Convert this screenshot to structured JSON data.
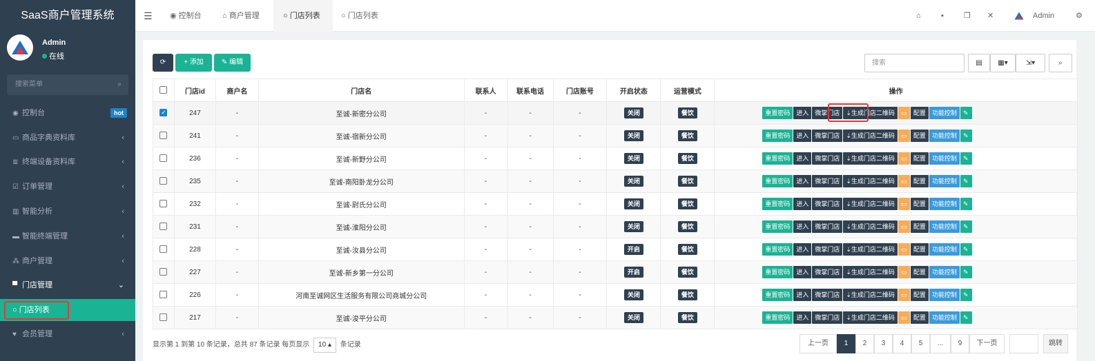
{
  "sidebar": {
    "brand": "SaaS商户管理系统",
    "user_name": "Admin",
    "user_status": "在线",
    "search_placeholder": "搜索菜单",
    "items": [
      {
        "icon": "dashboard-icon",
        "label": "控制台",
        "badge": "hot"
      },
      {
        "icon": "book-icon",
        "label": "商品字典资料库",
        "arrow": "‹"
      },
      {
        "icon": "database-icon",
        "label": "终端设备资料库",
        "arrow": "‹"
      },
      {
        "icon": "checklist-icon",
        "label": "订单管理",
        "arrow": "‹"
      },
      {
        "icon": "bar-chart-icon",
        "label": "智能分析",
        "arrow": "‹"
      },
      {
        "icon": "terminal-icon",
        "label": "智能终端管理",
        "arrow": "‹"
      },
      {
        "icon": "merchant-icon",
        "label": "商户管理",
        "arrow": "‹"
      },
      {
        "icon": "store-icon",
        "label": "门店管理",
        "arrow": "⌄"
      },
      {
        "icon": "member-icon",
        "label": "会员管理",
        "arrow": "‹"
      }
    ],
    "active_sub": "门店列表"
  },
  "topbar": {
    "menu_icon": "☰",
    "tabs": [
      {
        "icon": "dashboard-icon",
        "label": "控制台"
      },
      {
        "icon": "bank-icon",
        "label": "商户管理"
      },
      {
        "icon": "circle-icon",
        "label": "门店列表"
      },
      {
        "icon": "circle-icon",
        "label": "门店列表"
      }
    ],
    "admin": "Admin"
  },
  "toolbar": {
    "refresh": "⟳",
    "add": "+ 添加",
    "edit": "✎ 编辑",
    "search_placeholder": "搜索"
  },
  "table": {
    "headers": [
      "门店id",
      "商户名",
      "门店名",
      "联系人",
      "联系电话",
      "门店账号",
      "开启状态",
      "运营模式",
      "操作"
    ],
    "op_labels": [
      "重置密码",
      "进入",
      "微掌门店",
      "生成门店二维码",
      "配置",
      "功能控制"
    ],
    "rows": [
      {
        "id": "247",
        "merchant": "-",
        "name": "至诚-新密分公司",
        "contact": "-",
        "phone": "-",
        "account": "-",
        "status": "关闭",
        "mode": "餐饮",
        "checked": true
      },
      {
        "id": "241",
        "merchant": "-",
        "name": "至诚-宿新分公司",
        "contact": "-",
        "phone": "-",
        "account": "-",
        "status": "关闭",
        "mode": "餐饮",
        "checked": false
      },
      {
        "id": "236",
        "merchant": "-",
        "name": "至诚-新野分公司",
        "contact": "-",
        "phone": "-",
        "account": "-",
        "status": "关闭",
        "mode": "餐饮",
        "checked": false
      },
      {
        "id": "235",
        "merchant": "-",
        "name": "至诚-南阳卧龙分公司",
        "contact": "-",
        "phone": "-",
        "account": "-",
        "status": "关闭",
        "mode": "餐饮",
        "checked": false
      },
      {
        "id": "232",
        "merchant": "-",
        "name": "至诚-尉氏分公司",
        "contact": "-",
        "phone": "-",
        "account": "-",
        "status": "关闭",
        "mode": "餐饮",
        "checked": false
      },
      {
        "id": "231",
        "merchant": "-",
        "name": "至诚-淮阳分公司",
        "contact": "-",
        "phone": "-",
        "account": "-",
        "status": "关闭",
        "mode": "餐饮",
        "checked": false
      },
      {
        "id": "228",
        "merchant": "-",
        "name": "至诚-汝县分公司",
        "contact": "-",
        "phone": "-",
        "account": "-",
        "status": "开启",
        "mode": "餐饮",
        "checked": false
      },
      {
        "id": "227",
        "merchant": "-",
        "name": "至诚-新乡第一分公司",
        "contact": "-",
        "phone": "-",
        "account": "-",
        "status": "开启",
        "mode": "餐饮",
        "checked": false
      },
      {
        "id": "226",
        "merchant": "-",
        "name": "河南至诚网区生活服务有限公司商城分公司",
        "contact": "-",
        "phone": "-",
        "account": "-",
        "status": "关闭",
        "mode": "餐饮",
        "checked": false
      },
      {
        "id": "217",
        "merchant": "-",
        "name": "至诚-浚平分公司",
        "contact": "-",
        "phone": "-",
        "account": "-",
        "status": "关闭",
        "mode": "餐饮",
        "checked": false
      }
    ]
  },
  "pagination": {
    "info_prefix": "显示第 1 到第 10 条记录，总共 87 条记录 每页显示",
    "page_size": "10 ▴",
    "info_suffix": "条记录",
    "prev": "上一页",
    "pages": [
      "1",
      "2",
      "3",
      "4",
      "5",
      "...",
      "9"
    ],
    "next": "下一页",
    "jump": "跳转"
  }
}
